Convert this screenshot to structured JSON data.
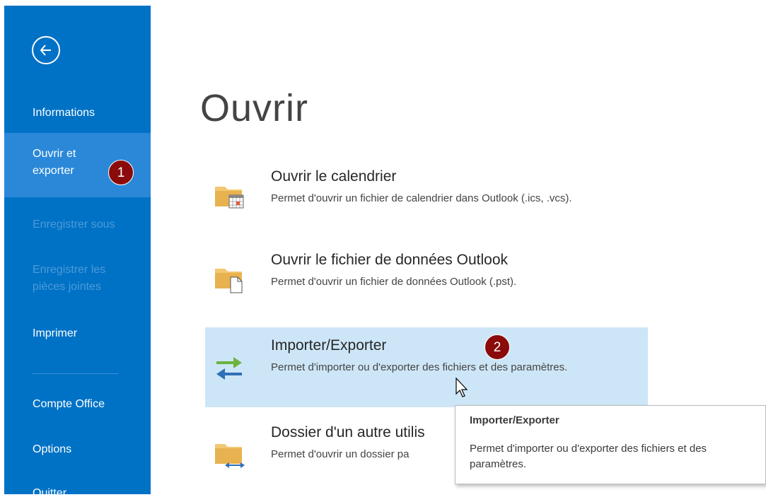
{
  "sidebar": {
    "items": [
      {
        "label": "Informations"
      },
      {
        "label": "Ouvrir et exporter"
      },
      {
        "label": "Enregistrer sous"
      },
      {
        "label": "Enregistrer les pièces jointes"
      },
      {
        "label": "Imprimer"
      },
      {
        "label": "Compte Office"
      },
      {
        "label": "Options"
      },
      {
        "label": "Quitter"
      }
    ],
    "selected": "Ouvrir et exporter",
    "back_icon": "back-arrow-icon"
  },
  "main": {
    "title": "Ouvrir",
    "options": [
      {
        "title": "Ouvrir le calendrier",
        "desc": "Permet d'ouvrir un fichier de calendrier dans Outlook (.ics, .vcs).",
        "icon": "folder-calendar-icon"
      },
      {
        "title": "Ouvrir le fichier de données Outlook",
        "desc": "Permet d'ouvrir un fichier de données Outlook (.pst).",
        "icon": "folder-file-icon"
      },
      {
        "title": "Importer/Exporter",
        "desc": "Permet d'importer ou d'exporter des fichiers et des paramètres.",
        "icon": "import-export-arrows-icon"
      },
      {
        "title": "Dossier d'un autre utilis",
        "desc": "Permet d'ouvrir un dossier pa",
        "icon": "folder-shared-icon"
      }
    ]
  },
  "tooltip": {
    "title": "Importer/Exporter",
    "desc": "Permet d'importer ou d'exporter des fichiers et des paramètres."
  },
  "annotations": {
    "step1": "1",
    "step2": "2"
  },
  "colors": {
    "sidebar": "#0072c6",
    "sidebar_selected": "#2b88d8",
    "hover": "#cde6f7",
    "badge": "#8b0a0a"
  }
}
